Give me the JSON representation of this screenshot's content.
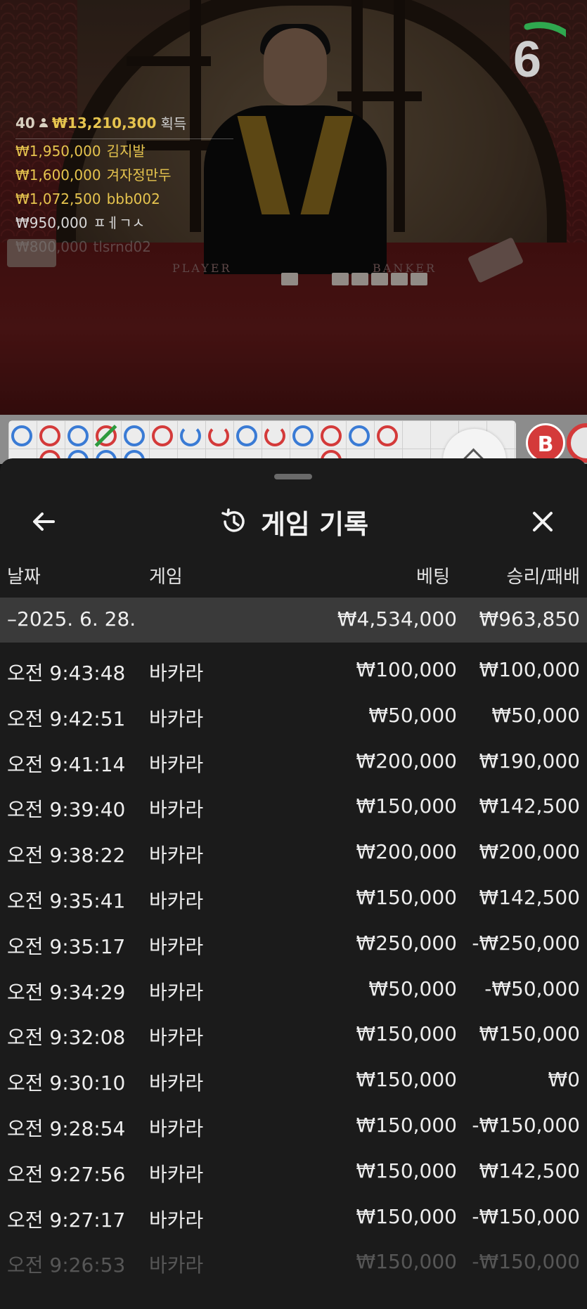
{
  "video": {
    "table_player": "PLAYER",
    "table_banker": "BANKER",
    "leaderboard": {
      "count": "40",
      "total": "₩13,210,300",
      "total_suffix": "획득",
      "entries": [
        {
          "amount": "₩1,950,000",
          "name": "김지발"
        },
        {
          "amount": "₩1,600,000",
          "name": "겨자정만두"
        },
        {
          "amount": "₩1,072,500",
          "name": "bbb002"
        },
        {
          "amount": "₩950,000",
          "name": "ㅍㅔㄱㅅ"
        },
        {
          "amount": "₩800,000",
          "name": "tlsrnd02"
        }
      ]
    },
    "countdown": "6"
  },
  "road": {
    "prediction_banker_label": "B"
  },
  "history": {
    "title": "게임 기록",
    "icons": {
      "back": "arrow-left-icon",
      "history": "history-icon",
      "close": "close-icon"
    },
    "columns": {
      "date": "날짜",
      "game": "게임",
      "bet": "베팅",
      "result": "승리/패배"
    },
    "day": {
      "date": "–2025. 6. 28.",
      "bet": "₩4,534,000",
      "result": "₩963,850"
    },
    "rows": [
      {
        "time": "오전 9:43:48",
        "game": "바카라",
        "bet": "₩100,000",
        "result": "₩100,000"
      },
      {
        "time": "오전 9:42:51",
        "game": "바카라",
        "bet": "₩50,000",
        "result": "₩50,000"
      },
      {
        "time": "오전 9:41:14",
        "game": "바카라",
        "bet": "₩200,000",
        "result": "₩190,000"
      },
      {
        "time": "오전 9:39:40",
        "game": "바카라",
        "bet": "₩150,000",
        "result": "₩142,500"
      },
      {
        "time": "오전 9:38:22",
        "game": "바카라",
        "bet": "₩200,000",
        "result": "₩200,000"
      },
      {
        "time": "오전 9:35:41",
        "game": "바카라",
        "bet": "₩150,000",
        "result": "₩142,500"
      },
      {
        "time": "오전 9:35:17",
        "game": "바카라",
        "bet": "₩250,000",
        "result": "-₩250,000"
      },
      {
        "time": "오전 9:34:29",
        "game": "바카라",
        "bet": "₩50,000",
        "result": "-₩50,000"
      },
      {
        "time": "오전 9:32:08",
        "game": "바카라",
        "bet": "₩150,000",
        "result": "₩150,000"
      },
      {
        "time": "오전 9:30:10",
        "game": "바카라",
        "bet": "₩150,000",
        "result": "₩0"
      },
      {
        "time": "오전 9:28:54",
        "game": "바카라",
        "bet": "₩150,000",
        "result": "-₩150,000"
      },
      {
        "time": "오전 9:27:56",
        "game": "바카라",
        "bet": "₩150,000",
        "result": "₩142,500"
      },
      {
        "time": "오전 9:27:17",
        "game": "바카라",
        "bet": "₩150,000",
        "result": "-₩150,000"
      },
      {
        "time": "오전 9:26:53",
        "game": "바카라",
        "bet": "₩150,000",
        "result": "-₩150,000"
      }
    ]
  }
}
